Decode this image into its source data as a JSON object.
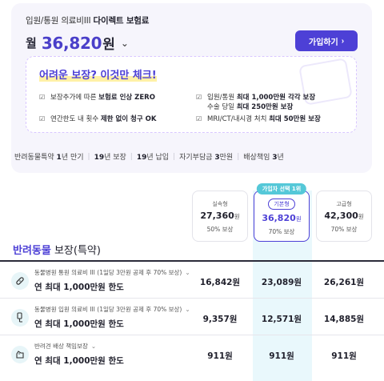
{
  "header": {
    "product_prefix": "입원/통원 의료비III",
    "product_name": "다이렉트 보험료",
    "price_prefix": "월",
    "price_amount": "36,820",
    "price_unit": "원",
    "join_label": "가입하기"
  },
  "checklist": {
    "title": "어려운 보장? 이것만 체크!",
    "items": [
      {
        "pre": "보장추가에 따른 ",
        "bold": "보험료 인상 ZERO",
        "post": ""
      },
      {
        "pre": "입원/통원 ",
        "bold": "최대 1,000만원 각각 보장",
        "post": "",
        "line2_pre": "수술 당일 ",
        "line2_bold": "최대 250만원 보장"
      },
      {
        "pre": "연간한도 내 횟수 ",
        "bold": "제한 없이 청구 OK",
        "post": ""
      },
      {
        "pre": "MRI/CT/내시경 처치 ",
        "bold": "최대 50만원 보장",
        "post": ""
      }
    ]
  },
  "terms": [
    {
      "label": "반려동물특약 ",
      "bold": "1",
      "rest": "년 만기"
    },
    {
      "label": "",
      "bold": "19",
      "rest": "년 보장"
    },
    {
      "label": "",
      "bold": "19",
      "rest": "년 납입"
    },
    {
      "label": "자기부담금 ",
      "bold": "3",
      "rest": "만원"
    },
    {
      "label": "배상책임 ",
      "bold": "3",
      "rest": "년"
    }
  ],
  "plans": [
    {
      "name": "실속형",
      "price": "27,360",
      "unit": "원",
      "coverage": "50% 보상"
    },
    {
      "name": "기본형",
      "price": "36,820",
      "unit": "원",
      "coverage": "70% 보상",
      "tag": "가입자 선택 1위"
    },
    {
      "name": "고급형",
      "price": "42,300",
      "unit": "원",
      "coverage": "70% 보상"
    }
  ],
  "section": {
    "accent": "반려동물",
    "rest": " 보장(특약)"
  },
  "rows": [
    {
      "sub": "동물병원 통원 의료비 III (1일당 3만원 공제 후 70% 보상)",
      "main": "연 최대 1,000만원 한도",
      "values": [
        "16,842원",
        "23,089원",
        "26,261원"
      ],
      "icon": "bandage-icon"
    },
    {
      "sub": "동물병원 입원 의료비 III (1일당 3만원 공제 후 70% 보상)",
      "main": "연 최대 1,000만원 한도",
      "values": [
        "9,357원",
        "12,571원",
        "14,885원"
      ],
      "icon": "iv-drip-icon"
    },
    {
      "sub": "반려견 배상 책임보장",
      "main": "연 최대 1,000만원 한도",
      "values": [
        "911원",
        "911원",
        "911원"
      ],
      "icon": "dog-icon"
    }
  ],
  "colors": {
    "accent": "#4d40d6",
    "tag": "#55c8d8",
    "highlight": "#e9f8fc"
  }
}
